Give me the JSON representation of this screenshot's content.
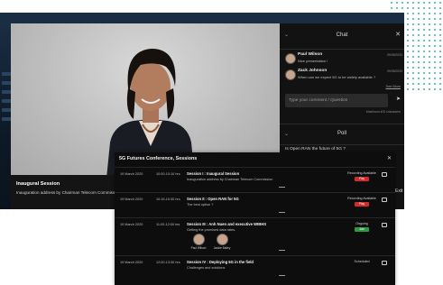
{
  "video": {
    "session_title": "Inaugural Session",
    "session_subtitle": "Inauguration address by Chairman Telecom Commiss"
  },
  "chat": {
    "title": "Chat",
    "messages": [
      {
        "name": "Paul Wilson",
        "text": "Nice presentation !",
        "time": "09/08/2020"
      },
      {
        "name": "Zack Johnson",
        "text": "When can we expect 5G to be widely available ?",
        "time": "09/08/2020"
      }
    ],
    "see_more": "See More",
    "input_placeholder": "Type your comment / Question",
    "max_chars": "Maximum 400 characters"
  },
  "poll": {
    "title": "Poll",
    "question": "Is Open RAN the future of 5G ?"
  },
  "exit_label": "Exit",
  "sessions": {
    "heading": "5G Futures Conference, Sessions",
    "rows": [
      {
        "date": "19 March 2020",
        "time": "10:00-10:10 hrs",
        "title": "Session I : Inaugural Session",
        "desc": "Inauguration address by Chairman Telecom Commission",
        "status": "Recording Available",
        "badge": "Play",
        "badge_color": "#d42a2a"
      },
      {
        "date": "19 March 2020",
        "time": "10:15-10:30 hrs",
        "title": "Session II : Open RAN for 5G",
        "desc": "The best option ?",
        "status": "Recording Available",
        "badge": "Play",
        "badge_color": "#d42a2a"
      },
      {
        "date": "19 March 2020",
        "time": "11:00-12:00 hrs",
        "title": "Session III : Anh Nuen and executive WIBHS",
        "desc": "Getting the promised data rates.",
        "status": "Ongoing",
        "badge": "Join",
        "badge_color": "#2f9a45",
        "speakers": [
          "Paul Wilson",
          "Jackie Bailey"
        ]
      },
      {
        "date": "19 March 2020",
        "time": "12:00-13:30 hrs",
        "title": "Session IV : Deploying 5G in the field",
        "desc": "Challenges and solutions",
        "status": "Scheduled",
        "badge": "",
        "badge_color": ""
      }
    ]
  }
}
